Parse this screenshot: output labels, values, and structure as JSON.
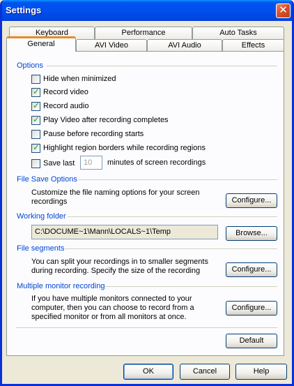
{
  "window": {
    "title": "Settings"
  },
  "tabs_row1": [
    {
      "label": "Keyboard"
    },
    {
      "label": "Performance"
    },
    {
      "label": "Auto Tasks"
    }
  ],
  "tabs_row2": [
    {
      "label": "General",
      "active": true
    },
    {
      "label": "AVI Video"
    },
    {
      "label": "AVI Audio"
    },
    {
      "label": "Effects"
    }
  ],
  "options": {
    "title": "Options",
    "items": [
      {
        "label": "Hide when minimized",
        "checked": false
      },
      {
        "label": "Record video",
        "checked": true
      },
      {
        "label": "Record audio",
        "checked": true
      },
      {
        "label": "Play Video after recording completes",
        "checked": true
      },
      {
        "label": "Pause before recording starts",
        "checked": false
      },
      {
        "label": "Highlight region borders while recording regions",
        "checked": true
      }
    ],
    "save_last": {
      "label": "Save last",
      "checked": false,
      "value": "10",
      "suffix": "minutes of screen recordings"
    }
  },
  "file_save": {
    "title": "File Save Options",
    "description_line1": "Customize the file naming options for your screen",
    "description_line2": "recordings",
    "button": "Configure..."
  },
  "working_folder": {
    "title": "Working folder",
    "path": "C:\\DOCUME~1\\Mann\\LOCALS~1\\Temp",
    "button": "Browse..."
  },
  "file_segments": {
    "title": "File segments",
    "description_line1": "You can split your recordings in to smaller segments",
    "description_line2": "during recording. Specify the size of the recording",
    "button": "Configure..."
  },
  "multi_monitor": {
    "title": "Multiple monitor recording",
    "description_line1": "If you have multiple monitors connected to your",
    "description_line2": "computer, then you can choose to record from a",
    "description_line3": "specified monitor or from all monitors at once.",
    "button": "Configure..."
  },
  "default_button": "Default",
  "footer": {
    "ok": "OK",
    "cancel": "Cancel",
    "help": "Help"
  }
}
